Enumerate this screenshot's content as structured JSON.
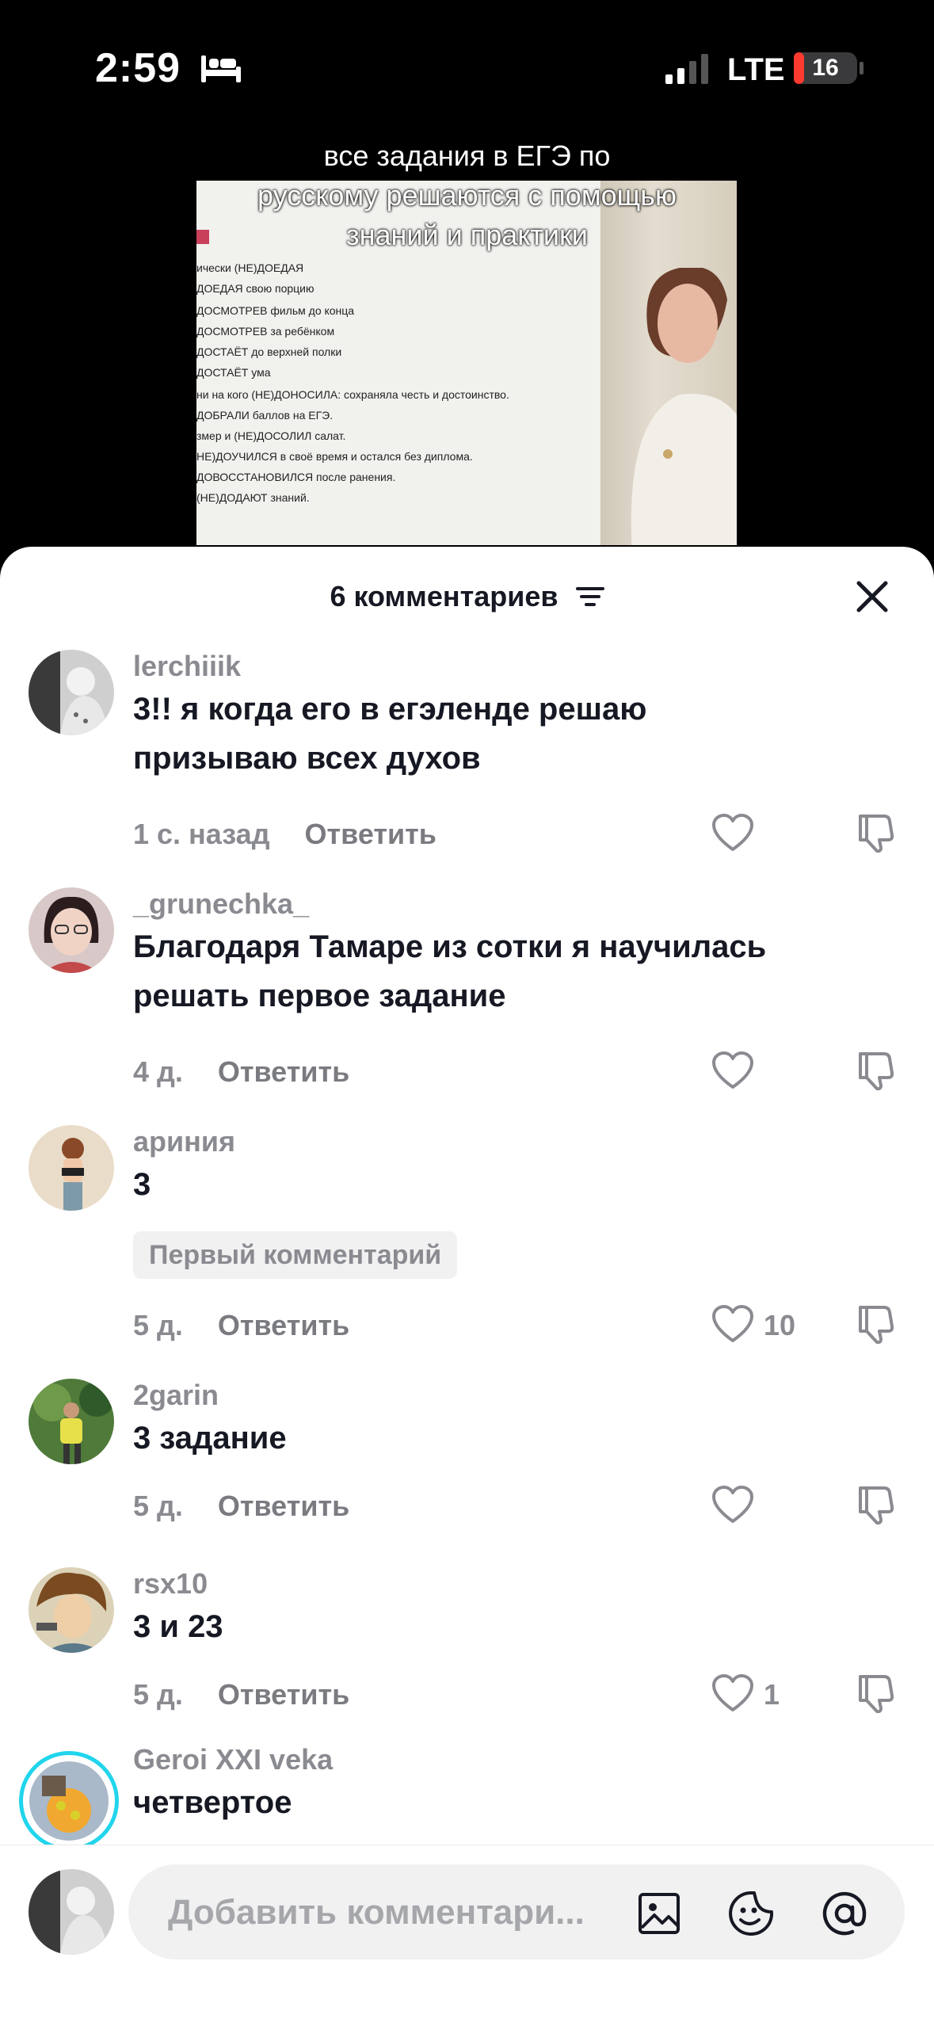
{
  "status_bar": {
    "time": "2:59",
    "network": "LTE",
    "battery": "16",
    "battery_level": 0.16
  },
  "video": {
    "caption": "все задания в ЕГЭ по русскому решаются с помощью знаний и практики",
    "caption_lines": [
      "все задания в ЕГЭ по",
      "русскому решаются с помощью",
      "знаний и практики"
    ]
  },
  "sheet": {
    "title": "6 комментариев"
  },
  "comments": [
    {
      "user": "lerchiiik",
      "text_lines": [
        "3!! я когда его в егэленде решаю",
        "призываю всех духов"
      ],
      "time": "1 с. назад",
      "reply": "Ответить",
      "likes": ""
    },
    {
      "user": "_grunechka_",
      "text_lines": [
        "Благодаря Тамаре из сотки я научилась",
        "решать первое задание"
      ],
      "time": "4 д.",
      "reply": "Ответить",
      "likes": ""
    },
    {
      "user": "ариния",
      "text_lines": [
        "3"
      ],
      "badge": "Первый комментарий",
      "time": "5 д.",
      "reply": "Ответить",
      "likes": "10"
    },
    {
      "user": "2garin",
      "text_lines": [
        "3 задание"
      ],
      "time": "5 д.",
      "reply": "Ответить",
      "likes": ""
    },
    {
      "user": "rsx10",
      "text_lines": [
        "3 и 23"
      ],
      "time": "5 д.",
      "reply": "Ответить",
      "likes": "1"
    },
    {
      "user": "Geroi XXI veka",
      "text_lines": [
        "четвертое"
      ]
    }
  ],
  "input": {
    "placeholder": "Добавить комментари..."
  },
  "colors": {
    "accent_ring": "#20d5ec",
    "text": "#161823",
    "muted": "#8a8b91"
  }
}
